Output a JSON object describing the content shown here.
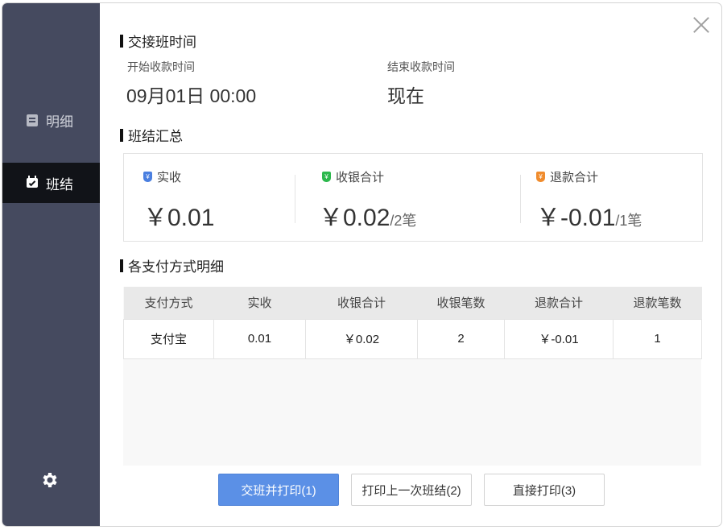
{
  "sidebar": {
    "items": [
      {
        "label": "明细",
        "icon": "list-icon",
        "active": false
      },
      {
        "label": "班结",
        "icon": "calendar-check-icon",
        "active": true
      }
    ],
    "settings_icon": "gear-icon"
  },
  "handover_time": {
    "title": "交接班时间",
    "start_label": "开始收款时间",
    "start_value": "09月01日 00:00",
    "end_label": "结束收款时间",
    "end_value": "现在"
  },
  "summary": {
    "title": "班结汇总",
    "actual": {
      "label": "实收",
      "value": "￥0.01",
      "badge_color": "#4a7fe0"
    },
    "collected": {
      "label": "收银合计",
      "value": "￥0.02",
      "count": "/2笔",
      "badge_color": "#2db84d"
    },
    "refund": {
      "label": "退款合计",
      "value": "￥-0.01",
      "count": "/1笔",
      "badge_color": "#f08c2e"
    }
  },
  "payment_details": {
    "title": "各支付方式明细",
    "columns": [
      "支付方式",
      "实收",
      "收银合计",
      "收银笔数",
      "退款合计",
      "退款笔数"
    ],
    "rows": [
      [
        "支付宝",
        "0.01",
        "￥0.02",
        "2",
        "￥-0.01",
        "1"
      ]
    ]
  },
  "buttons": {
    "shift_print": "交班并打印(1)",
    "print_last": "打印上一次班结(2)",
    "direct_print": "直接打印(3)"
  },
  "colors": {
    "sidebar_bg": "#454a5f",
    "sidebar_active_bg": "#111318",
    "primary_button": "#5b90e6"
  }
}
